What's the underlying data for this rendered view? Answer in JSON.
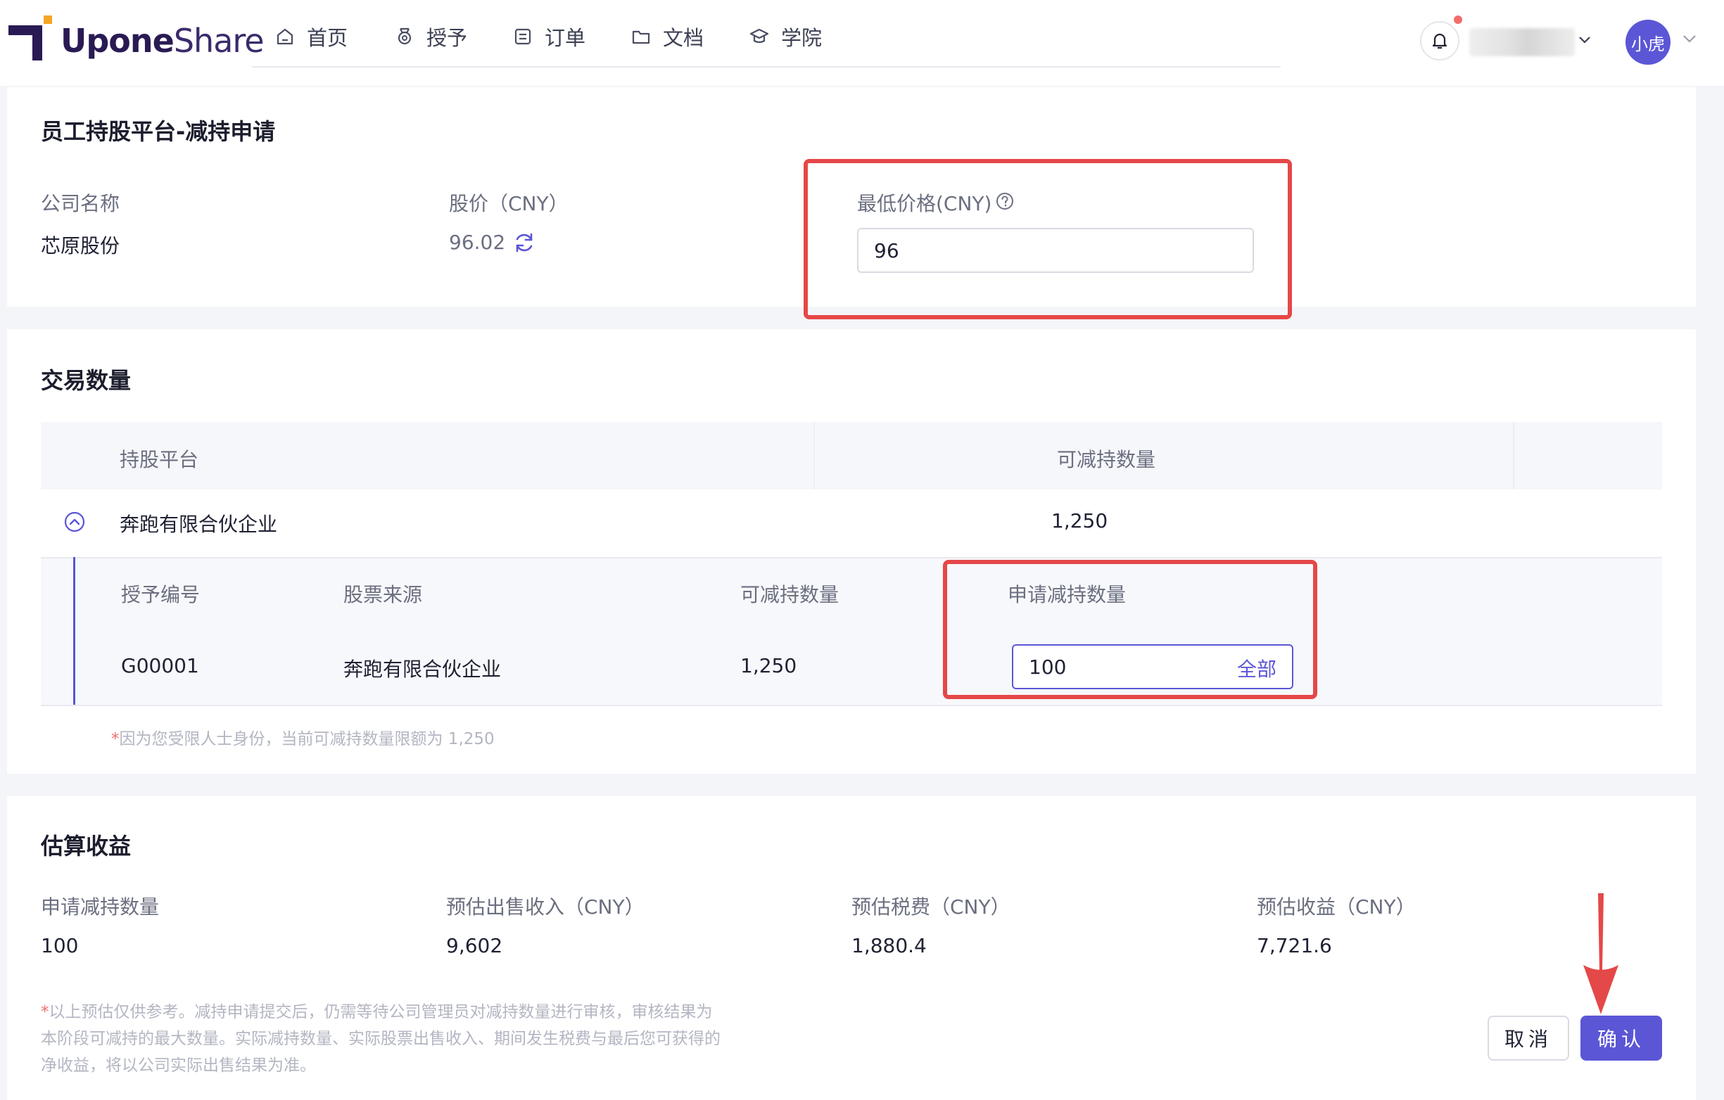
{
  "header": {
    "logo_bold": "Upone",
    "logo_light": "Share",
    "nav": [
      {
        "label": "首页",
        "icon": "home-icon"
      },
      {
        "label": "授予",
        "icon": "award-icon"
      },
      {
        "label": "订单",
        "icon": "order-icon"
      },
      {
        "label": "文档",
        "icon": "folder-icon"
      },
      {
        "label": "学院",
        "icon": "graduation-cap-icon"
      }
    ],
    "avatar_text": "小虎"
  },
  "apply": {
    "title": "员工持股平台-减持申请",
    "company_label": "公司名称",
    "company_value": "芯原股份",
    "price_label": "股价（CNY）",
    "price_value": "96.02",
    "min_price_label": "最低价格(CNY)",
    "min_price_value": "96"
  },
  "quantity": {
    "title": "交易数量",
    "col_platform": "持股平台",
    "col_reducible": "可减持数量",
    "row_platform": "奔跑有限合伙企业",
    "row_reducible": "1,250",
    "sub_cols": [
      "授予编号",
      "股票来源",
      "可减持数量",
      "申请减持数量"
    ],
    "sub_row": {
      "grant_id": "G00001",
      "source": "奔跑有限合伙企业",
      "reducible": "1,250",
      "apply_qty": "100",
      "all_label": "全部"
    },
    "note_star": "*",
    "note": "因为您受限人士身份，当前可减持数量限额为 1,250"
  },
  "estimate": {
    "title": "估算收益",
    "items": [
      {
        "label": "申请减持数量",
        "value": "100"
      },
      {
        "label": "预估出售收入（CNY）",
        "value": "9,602"
      },
      {
        "label": "预估税费（CNY）",
        "value": "1,880.4"
      },
      {
        "label": "预估收益（CNY）",
        "value": "7,721.6"
      }
    ],
    "note_star": "*",
    "note_lines": [
      "以上预估仅供参考。减持申请提交后，仍需等待公司管理员对减持数量进行审核，审核结果为",
      "本阶段可减持的最大数量。实际减持数量、实际股票出售收入、期间发生税费与最后您可获得的",
      "净收益，将以公司实际出售结果为准。"
    ],
    "cancel_label": "取消",
    "confirm_label": "确认"
  },
  "colors": {
    "accent": "#5b56d6",
    "highlight": "#e54848",
    "logo": "#2a1a54",
    "logo_square": "#f5a524"
  }
}
